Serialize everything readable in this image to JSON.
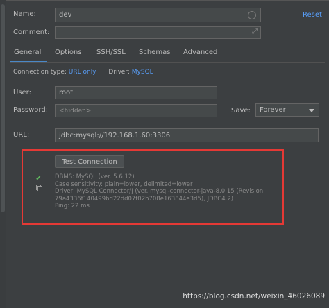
{
  "header": {
    "name_label": "Name:",
    "name_value": "dev",
    "reset_label": "Reset",
    "comment_label": "Comment:",
    "comment_value": ""
  },
  "tabs": [
    {
      "label": "General",
      "active": true
    },
    {
      "label": "Options",
      "active": false
    },
    {
      "label": "SSH/SSL",
      "active": false
    },
    {
      "label": "Schemas",
      "active": false
    },
    {
      "label": "Advanced",
      "active": false
    }
  ],
  "connection": {
    "type_label": "Connection type:",
    "type_value": "URL only",
    "driver_label": "Driver:",
    "driver_value": "MySQL"
  },
  "form": {
    "user_label": "User:",
    "user_value": "root",
    "password_label": "Password:",
    "password_value": "<hidden>",
    "save_label": "Save:",
    "save_value": "Forever",
    "url_label": "URL:",
    "url_value": "jdbc:mysql://192.168.1.60:3306"
  },
  "test": {
    "button_label": "Test Connection",
    "result_lines": [
      "DBMS: MySQL (ver. 5.6.12)",
      "Case sensitivity: plain=lower, delimited=lower",
      "Driver: MySQL Connector/J (ver. mysql-connector-java-8.0.15 (Revision:",
      "79a4336f140499bd22dd07f02b708e163844e3d5), JDBC4.2)",
      "Ping: 22 ms"
    ]
  },
  "watermark": "https://blog.csdn.net/weixin_46026089",
  "colors": {
    "background": "#3c3f41",
    "link": "#589df6",
    "highlight_border": "#e53935",
    "success": "#5fb85f"
  },
  "icons": {
    "success": "check-icon",
    "copy": "copy-icon",
    "expand": "expand-icon",
    "dropdown": "chevron-down-icon"
  }
}
